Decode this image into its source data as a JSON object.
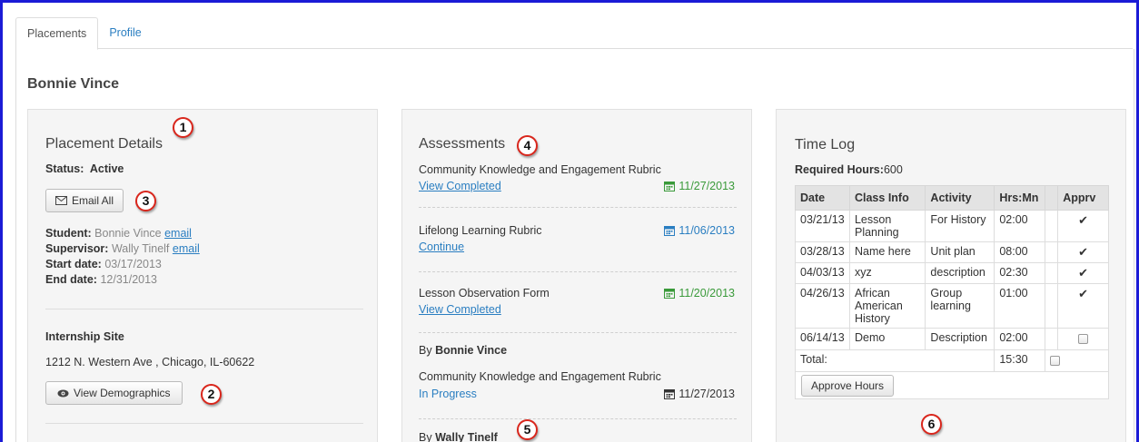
{
  "tabs": [
    {
      "label": "Placements",
      "active": true
    },
    {
      "label": "Profile",
      "active": false
    }
  ],
  "page_title": "Bonnie Vince",
  "placement": {
    "title": "Placement Details",
    "status_label": "Status:",
    "status_value": "Active",
    "email_all_label": "Email All",
    "student_label": "Student:",
    "student_name": "Bonnie Vince",
    "student_email_link": "email",
    "supervisor_label": "Supervisor:",
    "supervisor_name": "Wally Tinelf",
    "supervisor_email_link": "email",
    "start_label": "Start date:",
    "start_value": "03/17/2013",
    "end_label": "End date:",
    "end_value": "12/31/2013",
    "site_title": "Internship Site",
    "site_address": "1212 N. Western Ave , Chicago, IL-60622",
    "view_demographics_label": "View Demographics"
  },
  "assessments": {
    "title": "Assessments",
    "items": [
      {
        "name": "Community Knowledge and Engagement Rubric",
        "action": "View Completed",
        "date": "11/27/2013",
        "status": "completed"
      },
      {
        "name": "Lifelong Learning Rubric",
        "action": "Continue",
        "date": "11/06/2013",
        "status": "continue"
      },
      {
        "name": "Lesson Observation Form",
        "action": "View Completed",
        "date": "11/20/2013",
        "status": "completed"
      }
    ],
    "by_prefix": "By",
    "group1_name": "Bonnie Vince",
    "group1_item": {
      "name": "Community Knowledge and Engagement Rubric",
      "action": "In Progress",
      "date": "11/27/2013"
    },
    "group2_name": "Wally Tinelf"
  },
  "time_log": {
    "title": "Time Log",
    "required_label": "Required Hours:",
    "required_value": "600",
    "headers": [
      "Date",
      "Class Info",
      "Activity",
      "Hrs:Mn",
      "Apprv"
    ],
    "rows": [
      {
        "date": "03/21/13",
        "class_info": "Lesson Planning",
        "activity": "For History",
        "hrs": "02:00",
        "approved": true
      },
      {
        "date": "03/28/13",
        "class_info": "Name here",
        "activity": "Unit plan",
        "hrs": "08:00",
        "approved": true
      },
      {
        "date": "04/03/13",
        "class_info": "xyz",
        "activity": "description",
        "hrs": "02:30",
        "approved": true
      },
      {
        "date": "04/26/13",
        "class_info": "African American History",
        "activity": "Group learning",
        "hrs": "01:00",
        "approved": true
      },
      {
        "date": "06/14/13",
        "class_info": "Demo",
        "activity": "Description",
        "hrs": "02:00",
        "approved": false
      }
    ],
    "total_label": "Total:",
    "total_value": "15:30",
    "approve_button_label": "Approve Hours"
  },
  "callouts": [
    "1",
    "2",
    "3",
    "4",
    "5",
    "6"
  ],
  "colors": {
    "frame": "#1b1bd6",
    "link": "#2a7ec1",
    "date_green": "#3a9a3a",
    "callout_ring": "#d9261c"
  },
  "icons": {
    "email": "envelope-icon",
    "demographics": "eye-icon",
    "date": "calendar-icon",
    "approved": "checkmark-icon"
  }
}
